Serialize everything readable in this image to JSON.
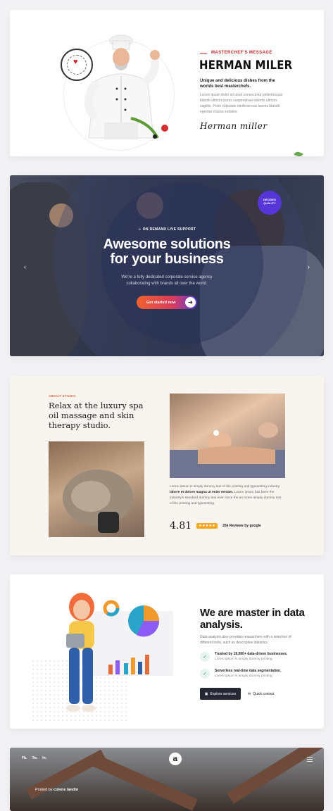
{
  "masterchef": {
    "kicker": "MASTERCHEF'S MESSAGE",
    "name": "HERMAN MILER",
    "subtitle": "Unique and delicious dishes from the worlds best masterchefs.",
    "body": "Lorem ipsum dolor sit amet consectetur pellentesque blandit ultrices purus suspendisse lobortis ultrices sagittis. Proin vulputate eleifend cras lacinia blandit egestas massa sodales.",
    "signature": "Herman miller"
  },
  "hero": {
    "tag": "ON DEMAND LIVE SUPPORT",
    "title_line1": "Awesome solutions",
    "title_line2": "for your business",
    "desc_line1": "We're a fully dedicated corporate service agency",
    "desc_line2": "collaborating with brands all over the world.",
    "cta": "Get started now",
    "badge_line1": "DECIDED",
    "badge_line2": "QUALITY"
  },
  "spa": {
    "kicker": "ABOUT STUDIO",
    "title": "Relax at the luxury spa oil massage and skin therapy studio.",
    "body_pre": "Lorem ipsum is simply dummy text of the printing and typesetting industry. ",
    "body_bold": "labore et dolore magna ut enim veniam.",
    "body_post": " Lorem ipsum has been the industry's standard dummy text ever since the an lorem simply dummy text of the printing and typesetting.",
    "score": "4.81",
    "stars": "★★★★★",
    "reviews": "25k Reviews by google"
  },
  "data": {
    "title": "We are master in data analysis.",
    "body": "Data analysis also provides researchers with a selection of different tools, such as descriptive statistics.",
    "features": [
      {
        "title": "Trusted by 16,000+ data-driven businesses.",
        "sub": "Lorem ipsum is simply dummy printing"
      },
      {
        "title": "Serverless real-time data segmentation.",
        "sub": "Lorem ipsum is simply dummy printing"
      }
    ],
    "primary_btn": "Explore services",
    "secondary_btn": "Quick contact"
  },
  "blog": {
    "social": [
      "Fb.",
      "Tw.",
      "In."
    ],
    "logo": "a",
    "posted_label": "Posted by",
    "author": "colene landin"
  },
  "colors": {
    "accent_red": "#c62828",
    "hero_btn": "#f0622e",
    "quality_badge": "#5636d9",
    "spa_kicker": "#e8643c",
    "dark_btn": "#232833"
  }
}
